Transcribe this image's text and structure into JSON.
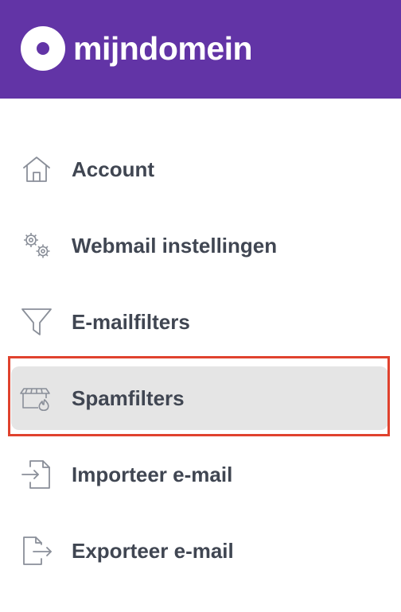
{
  "brand": {
    "name": "mijndomein",
    "color": "#6234a6"
  },
  "menu": {
    "items": [
      {
        "label": "Account",
        "icon": "home-icon",
        "active": false
      },
      {
        "label": "Webmail instellingen",
        "icon": "gears-icon",
        "active": false
      },
      {
        "label": "E-mailfilters",
        "icon": "funnel-icon",
        "active": false
      },
      {
        "label": "Spamfilters",
        "icon": "spam-filter-icon",
        "active": true
      },
      {
        "label": "Importeer e-mail",
        "icon": "import-icon",
        "active": false
      },
      {
        "label": "Exporteer e-mail",
        "icon": "export-icon",
        "active": false
      }
    ]
  },
  "colors": {
    "active_background": "#e5e5e5",
    "highlight_border": "#e0422e",
    "text": "#404652",
    "icon": "#8a8f99"
  }
}
